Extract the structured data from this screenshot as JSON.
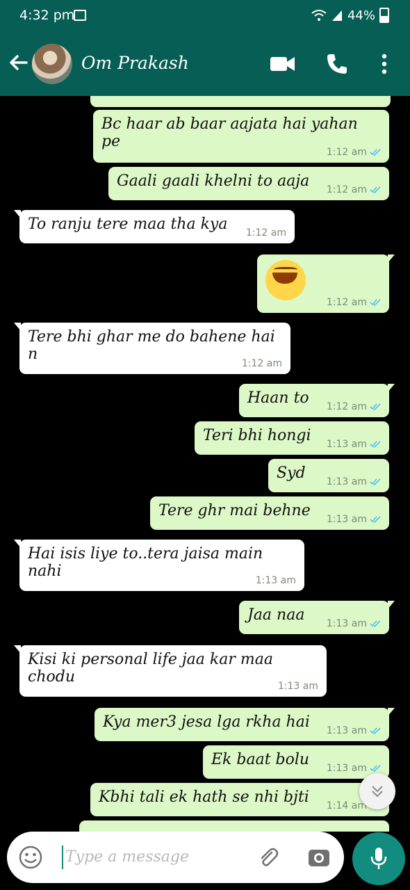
{
  "status": {
    "time": "4:32 pm",
    "battery": "44%"
  },
  "header": {
    "contact_name": "Om Prakash"
  },
  "messages": [
    {
      "dir": "out",
      "text": "Bc haar ab baar aajata hai yahan pe",
      "time": "1:12 am"
    },
    {
      "dir": "out",
      "text": "Gaali gaali khelni to aaja",
      "time": "1:12 am"
    },
    {
      "dir": "in",
      "text": "To ranju tere maa tha kya",
      "time": "1:12 am"
    },
    {
      "dir": "out",
      "text": "",
      "time": "1:12 am",
      "emoji": "laughing-emoji"
    },
    {
      "dir": "in",
      "text": "Tere bhi ghar me do bahene hai n",
      "time": "1:12 am"
    },
    {
      "dir": "out",
      "text": "Haan to",
      "time": "1:12 am"
    },
    {
      "dir": "out",
      "text": "Teri bhi hongi",
      "time": "1:13 am"
    },
    {
      "dir": "out",
      "text": "Syd",
      "time": "1:13 am"
    },
    {
      "dir": "out",
      "text": "Tere ghr mai behne",
      "time": "1:13 am"
    },
    {
      "dir": "in",
      "text": "Hai isis liye to..tera jaisa main nahi",
      "time": "1:13 am"
    },
    {
      "dir": "out",
      "text": "Jaa naa",
      "time": "1:13 am"
    },
    {
      "dir": "in",
      "text": "Kisi ki personal life jaa kar maa chodu",
      "time": "1:13 am"
    },
    {
      "dir": "out",
      "text": "Kya mer3 jesa lga rkha hai",
      "time": "1:13 am"
    },
    {
      "dir": "out",
      "text": "Ek baat bolu",
      "time": "1:13 am"
    },
    {
      "dir": "out",
      "text": "Kbhi tali ek hath se nhi bjti",
      "time": "1:14 am"
    }
  ],
  "composer": {
    "placeholder": "Type a message"
  },
  "colors": {
    "header": "#075e54",
    "outgoing": "#dcf8c6",
    "incoming": "#ffffff",
    "read_tick": "#4fc3f7",
    "mic": "#128c7e"
  }
}
